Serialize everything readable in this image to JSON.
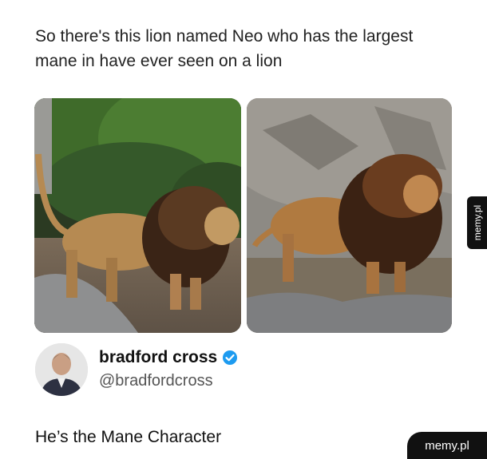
{
  "post": {
    "caption": "So there's this lion named Neo who has the largest mane in have ever seen on a lion"
  },
  "images": [
    {
      "subject": "lion-side-view-left"
    },
    {
      "subject": "lion-side-view-right"
    }
  ],
  "author": {
    "name": "bradford cross",
    "handle": "@bradfordcross",
    "verified": true,
    "verified_color": "#1d9bf0"
  },
  "reply": {
    "text": "He’s the Mane Character"
  },
  "watermarks": {
    "side": "memy.pl",
    "corner": "memy.pl"
  }
}
